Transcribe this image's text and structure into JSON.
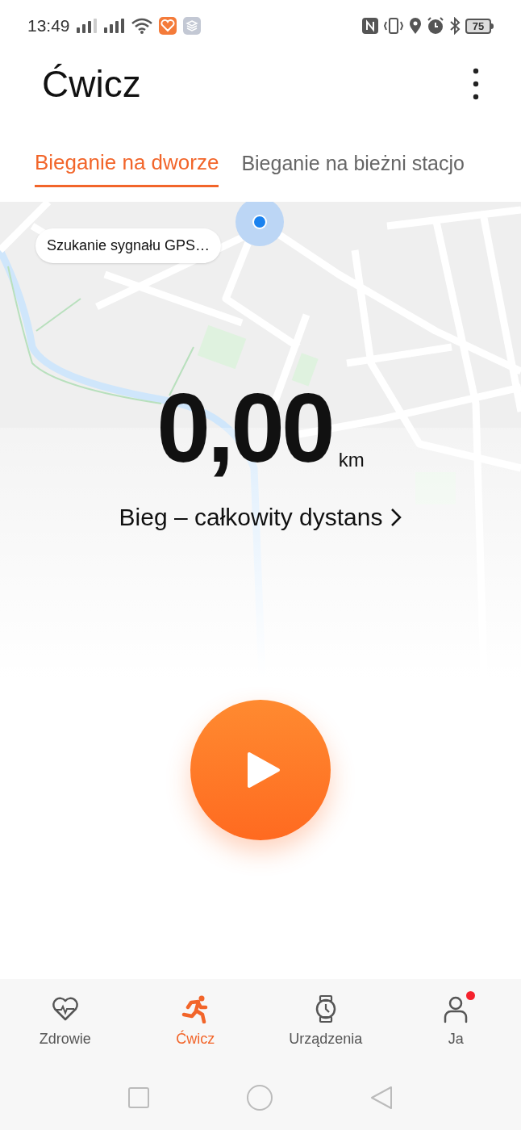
{
  "status_bar": {
    "time": "13:49",
    "battery": "75"
  },
  "header": {
    "title": "Ćwicz"
  },
  "tabs": [
    {
      "label": "Bieganie na dworze",
      "selected": true
    },
    {
      "label": "Bieganie na bieżni stacjo",
      "selected": false
    }
  ],
  "gps_status": "Szukanie sygnału GPS…",
  "distance": {
    "value": "0,00",
    "unit": "km",
    "label": "Bieg – całkowity dystans"
  },
  "bottom_nav": [
    {
      "label": "Zdrowie",
      "selected": false,
      "badge": false
    },
    {
      "label": "Ćwicz",
      "selected": true,
      "badge": false
    },
    {
      "label": "Urządzenia",
      "selected": false,
      "badge": false
    },
    {
      "label": "Ja",
      "selected": false,
      "badge": true
    }
  ]
}
